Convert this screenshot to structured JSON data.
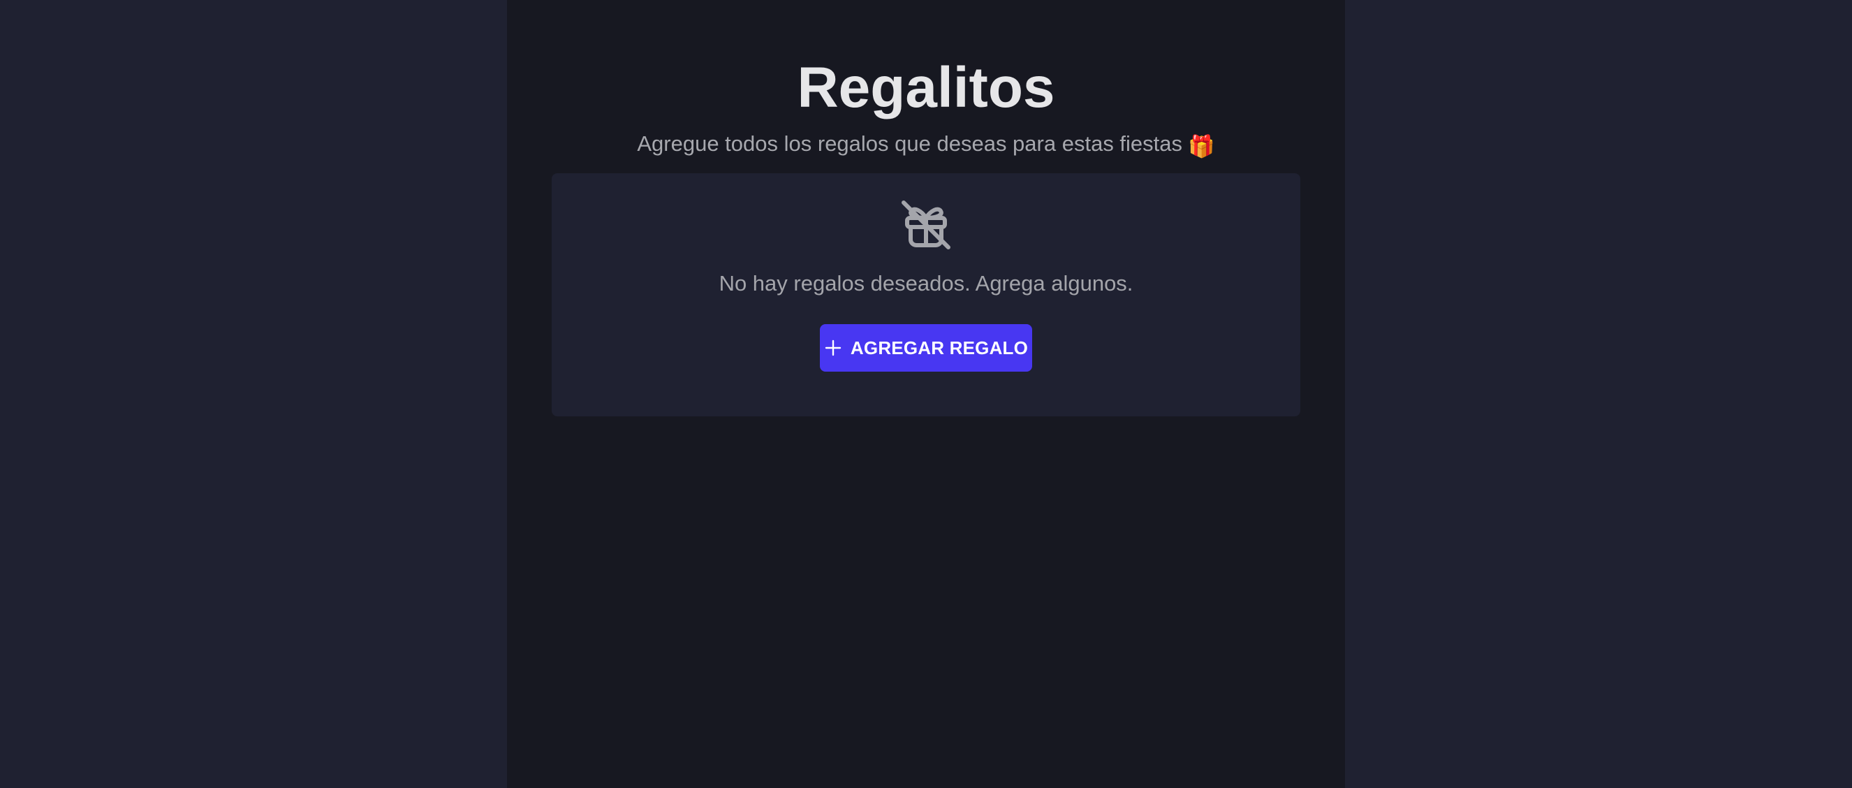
{
  "header": {
    "title": "Regalitos",
    "subtitle": "Agregue todos los regalos que deseas para estas fiestas",
    "subtitle_emoji": "🎁"
  },
  "empty_state": {
    "icon": "gift-off-icon",
    "message": "No hay regalos deseados. Agrega algunos.",
    "add_button_label": "AGREGAR REGALO",
    "add_button_icon": "plus-icon"
  },
  "colors": {
    "side_background": "#1f2131",
    "center_background": "#171821",
    "card_background": "#1f2131",
    "accent": "#4837f2",
    "title_text": "#e6e6e8",
    "muted_text": "#a7a8ae"
  }
}
